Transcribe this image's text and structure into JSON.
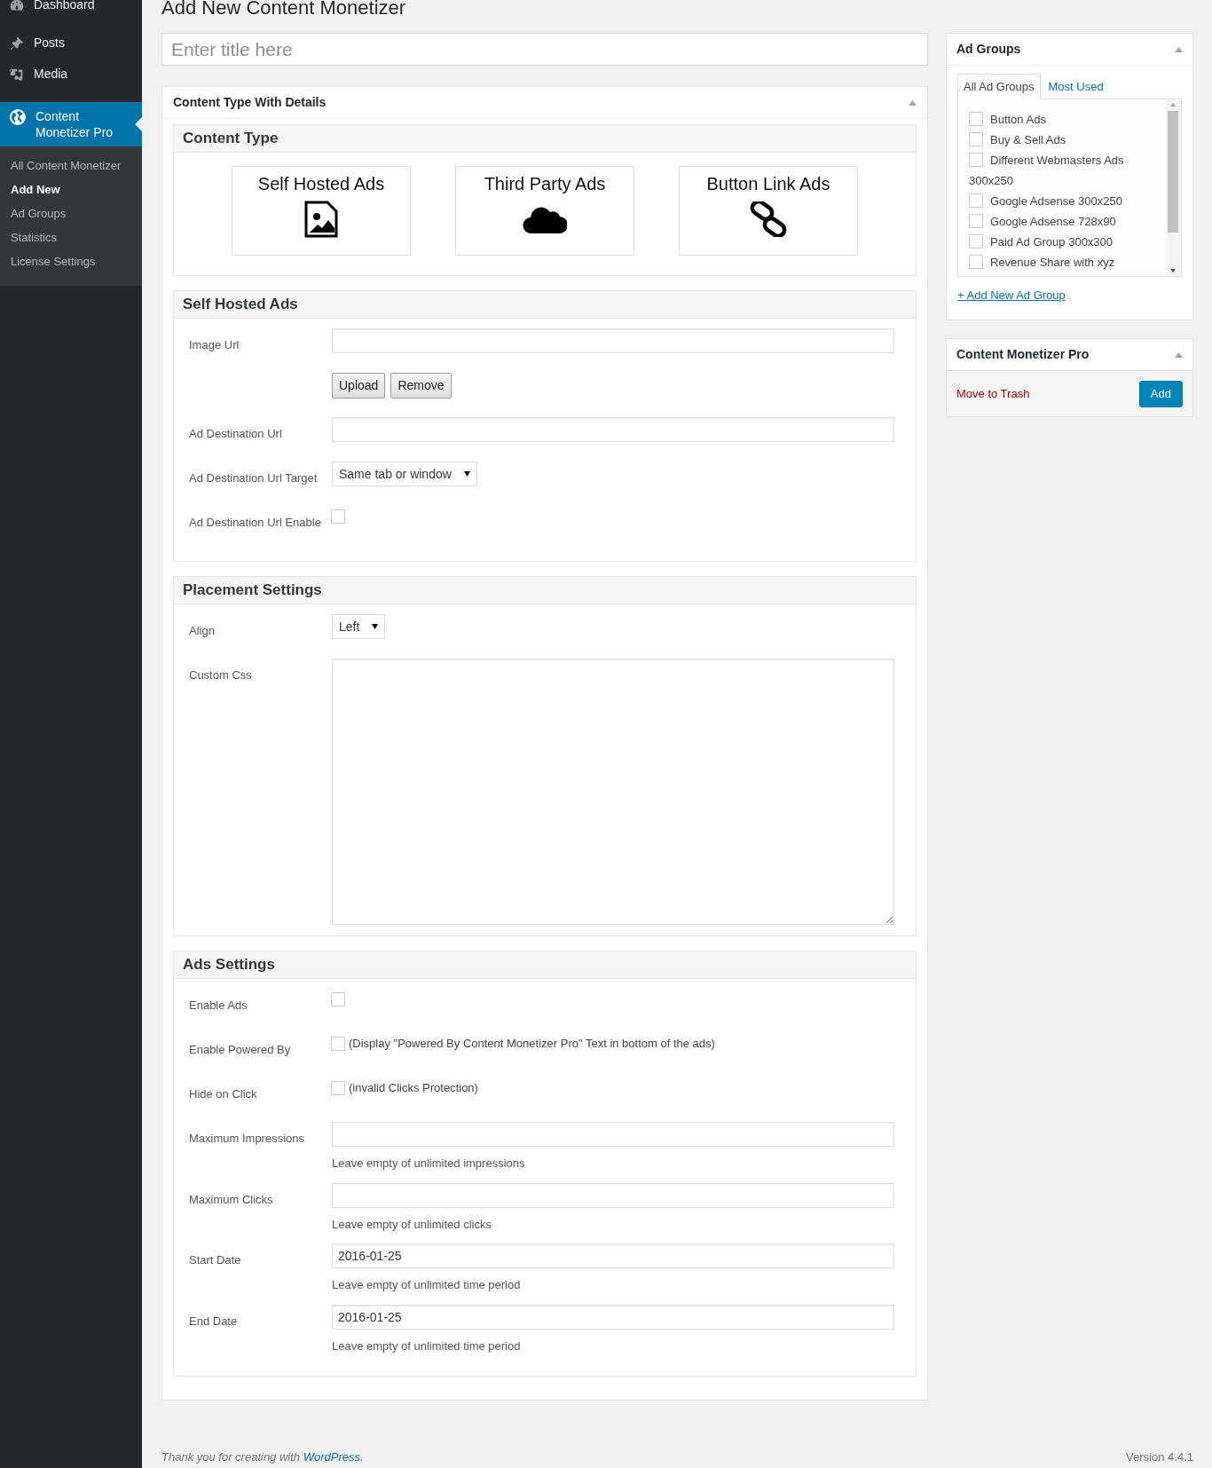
{
  "sidebar": {
    "menu": [
      {
        "label": "Dashboard",
        "selected": false
      },
      {
        "label": "Posts",
        "selected": false
      },
      {
        "label": "Media",
        "selected": false
      },
      {
        "label": "Content Monetizer Pro",
        "selected": true
      }
    ],
    "submenu": [
      {
        "label": "All Content Monetizer",
        "selected": false
      },
      {
        "label": "Add New",
        "selected": true
      },
      {
        "label": "Ad Groups",
        "selected": false
      },
      {
        "label": "Statistics",
        "selected": false
      },
      {
        "label": "License Settings",
        "selected": false
      }
    ]
  },
  "page_title": "Add New Content Monetizer",
  "title_field": {
    "placeholder": "Enter title here"
  },
  "content_box": {
    "title": "Content Type With Details",
    "sections": [
      {
        "kind": "types",
        "title": "Content Type",
        "types": [
          "Self Hosted Ads",
          "Third Party Ads",
          "Button Link Ads"
        ]
      },
      {
        "kind": "form",
        "title": "Self Hosted Ads",
        "rows": [
          {
            "kind": "text",
            "label": "Image Url"
          },
          {
            "kind": "buttons",
            "buttons": [
              "Upload",
              "Remove"
            ]
          },
          {
            "kind": "text",
            "label": "Ad Destination Url"
          },
          {
            "kind": "select",
            "label": "Ad Destination Url Target",
            "value": "Same tab or window"
          },
          {
            "kind": "checkbox",
            "label": "Ad Destination Url Enable",
            "checked": false
          }
        ]
      },
      {
        "kind": "form",
        "title": "Placement Settings",
        "rows": [
          {
            "kind": "select",
            "label": "Align",
            "value": "Left"
          },
          {
            "kind": "textarea",
            "label": "Custom Css"
          }
        ]
      },
      {
        "kind": "form",
        "title": "Ads Settings",
        "rows": [
          {
            "kind": "checkbox",
            "label": "Enable Ads",
            "checked": false
          },
          {
            "kind": "checkbox",
            "label": "Enable Powered By",
            "checked": false,
            "note": "(Display \"Powered By Content Monetizer Pro\" Text in bottom of the ads)"
          },
          {
            "kind": "checkbox",
            "label": "Hide on Click",
            "checked": false,
            "note": "(invalid Clicks Protection)"
          },
          {
            "kind": "text",
            "label": "Maximum Impressions",
            "help": "Leave empty of unlimited impressions"
          },
          {
            "kind": "text",
            "label": "Maximum Clicks",
            "help": "Leave empty of unlimited clicks"
          },
          {
            "kind": "text",
            "label": "Start Date",
            "value": "2016-01-25",
            "help": "Leave empty of unlimited time period"
          },
          {
            "kind": "text",
            "label": "End Date",
            "value": "2016-01-25",
            "help": "Leave empty of unlimited time period"
          }
        ]
      }
    ]
  },
  "ad_groups": {
    "title": "Ad Groups",
    "tabs": [
      {
        "label": "All Ad Groups",
        "selected": true
      },
      {
        "label": "Most Used",
        "selected": false
      }
    ],
    "items": [
      {
        "label": "Button Ads",
        "checked": false
      },
      {
        "label": "Buy & Sell Ads",
        "checked": false
      },
      {
        "label": "Different Webmasters Ads 300x250",
        "checked": false
      },
      {
        "label": "Google Adsense 300x250",
        "checked": false
      },
      {
        "label": "Google Adsense 728x90",
        "checked": false
      },
      {
        "label": "Paid Ad Group 300x300",
        "checked": false
      },
      {
        "label": "Revenue Share with xyz",
        "checked": false
      }
    ],
    "add_link": "+ Add New Ad Group"
  },
  "publish": {
    "title": "Content Monetizer Pro",
    "trash_link": "Move to Trash",
    "button": "Add"
  },
  "footer": {
    "thanks": "Thank you for creating with",
    "link": "WordPress",
    "after": ".",
    "version": "Version 4.4.1"
  }
}
